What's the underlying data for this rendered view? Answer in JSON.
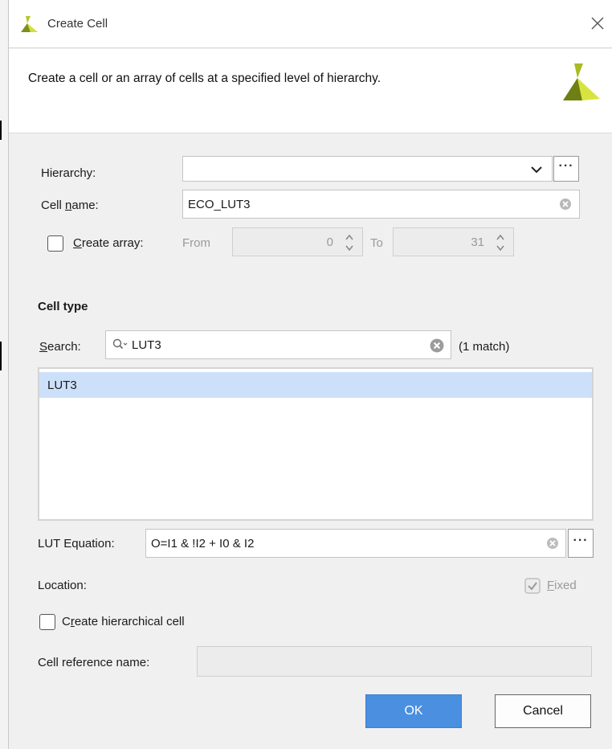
{
  "window": {
    "title": "Create Cell"
  },
  "header": {
    "description": "Create a cell or an array of cells at a specified level of hierarchy."
  },
  "form": {
    "hierarchy": {
      "label": "Hierarchy:",
      "value": ""
    },
    "cell_name": {
      "label_before": "Cell ",
      "label_mnemonic": "n",
      "label_after": "ame:",
      "value": "ECO_LUT3"
    },
    "create_array": {
      "label_mnemonic": "C",
      "label_after": "reate array:",
      "checked": false,
      "from_label": "From",
      "from_value": "0",
      "to_label": "To",
      "to_value": "31"
    }
  },
  "cell_type": {
    "heading": "Cell type",
    "search_label_mnemonic": "S",
    "search_label_after": "earch:",
    "search_value": "LUT3",
    "match_count": "(1 match)",
    "results": [
      "LUT3"
    ]
  },
  "lut_equation": {
    "label": "LUT Equation:",
    "value": "O=I1 & !I2 + I0 & I2"
  },
  "location": {
    "label": "Location:",
    "fixed_mnemonic": "F",
    "fixed_after": "ixed",
    "fixed_checked": true
  },
  "hierarchical": {
    "label_before": "C",
    "label_mnemonic": "r",
    "label_after": "eate hierarchical cell",
    "checked": false,
    "ref_label": "Cell reference name:",
    "ref_value": ""
  },
  "buttons": {
    "ok": "OK",
    "cancel": "Cancel"
  },
  "colors": {
    "accent": "#4a8fe0",
    "selection": "#cce0fa",
    "logo_dark": "#7a8a1a",
    "logo_light": "#c8d62a"
  }
}
